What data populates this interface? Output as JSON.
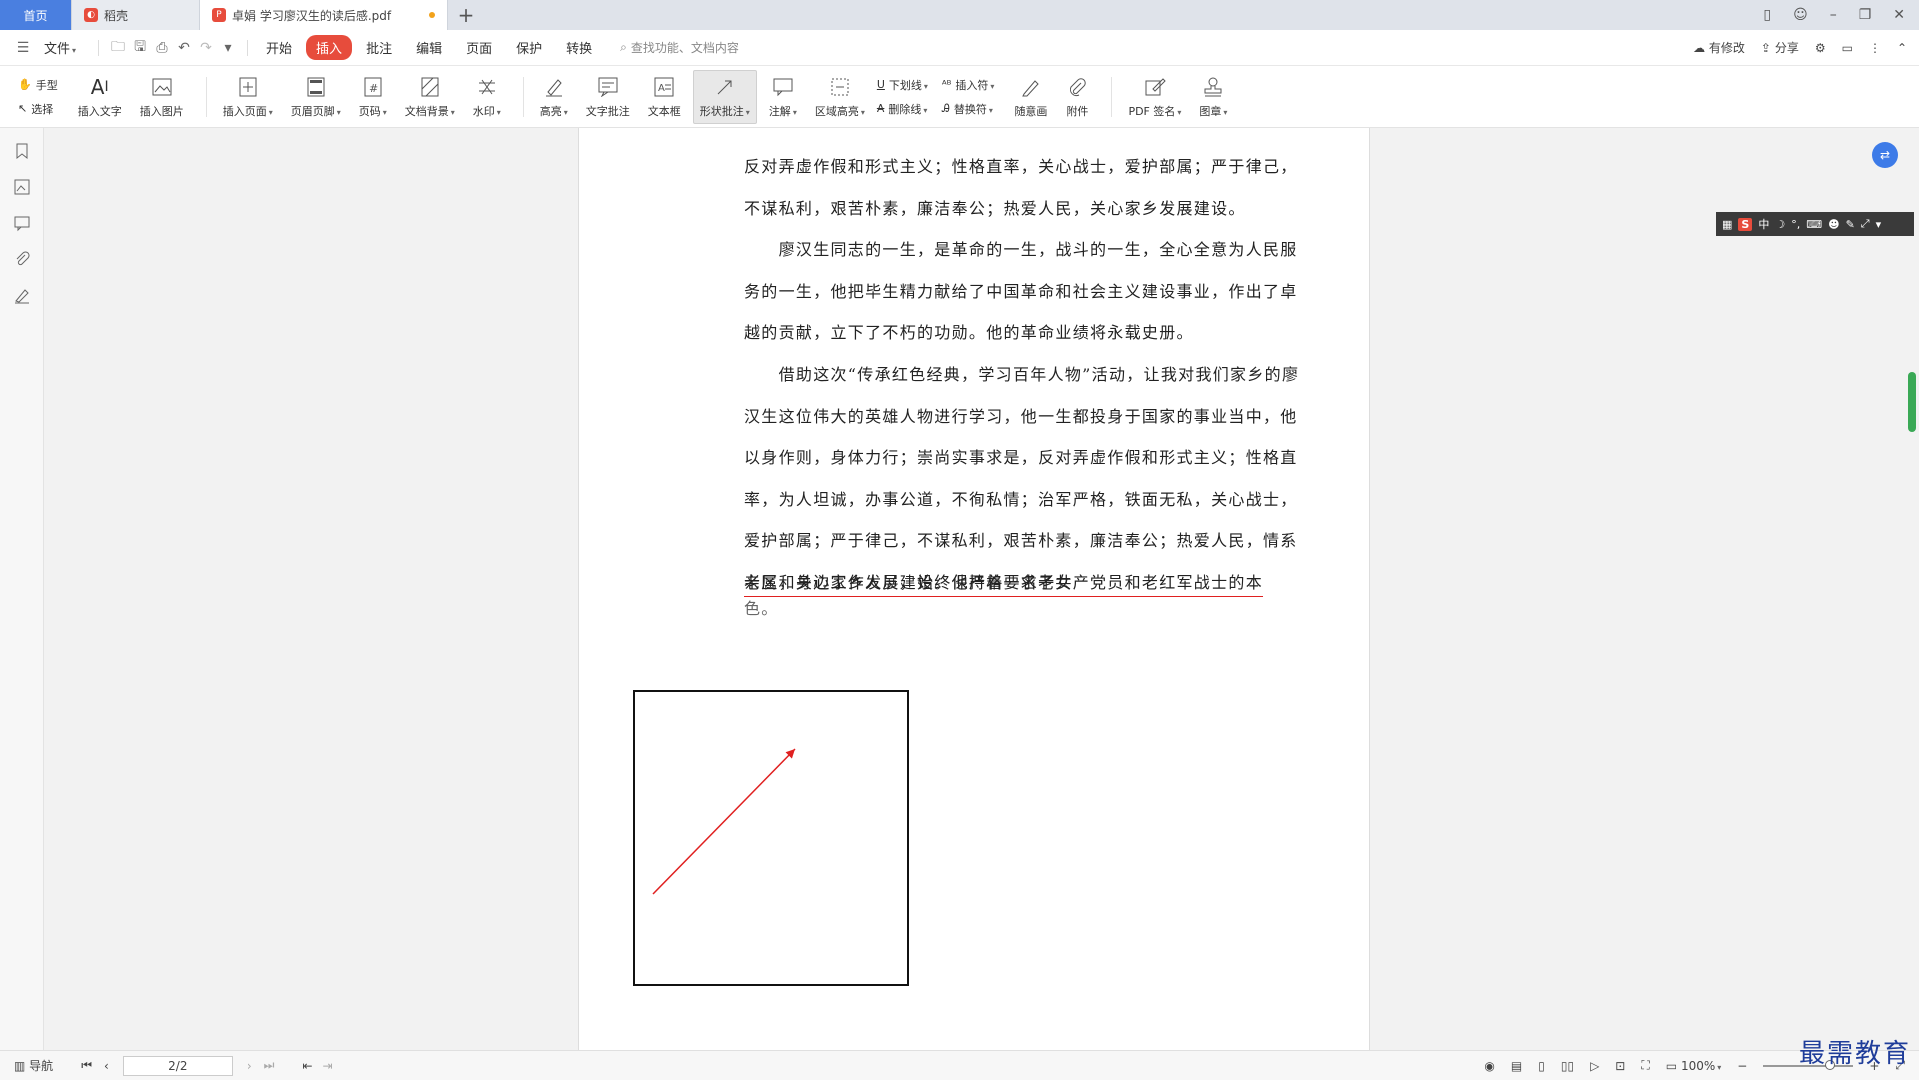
{
  "tabs": {
    "home": "首页",
    "wps": "稻壳",
    "doc": "卓娟 学习廖汉生的读后感.pdf"
  },
  "menu": {
    "file": "文件",
    "items": [
      "开始",
      "插入",
      "批注",
      "编辑",
      "页面",
      "保护",
      "转换"
    ],
    "search_placeholder": "查找功能、文档内容",
    "has_changes": "有修改",
    "share": "分享"
  },
  "ribbon": {
    "hand": "手型",
    "select": "选择",
    "insert_text": "插入文字",
    "insert_image": "插入图片",
    "insert_page": "插入页面",
    "header_footer": "页眉页脚",
    "page_num": "页码",
    "doc_bg": "文档背景",
    "watermark": "水印",
    "highlight": "高亮",
    "text_note": "文字批注",
    "text_box": "文本框",
    "shape_note": "形状批注",
    "annotation": "注解",
    "area_highlight": "区域高亮",
    "underline": "下划线",
    "strikethrough": "删除线",
    "insert_symbol": "插入符",
    "replace_symbol": "替换符",
    "freehand": "随意画",
    "attachment": "附件",
    "pdf_sign": "PDF 签名",
    "stamp": "图章"
  },
  "document": {
    "paragraphs": [
      "反对弄虚作假和形式主义；性格直率，关心战士，爱护部属；严于律己，不谋私利，艰苦朴素，廉洁奉公；热爱人民，关心家乡发展建设。",
      "　　廖汉生同志的一生，是革命的一生，战斗的一生，全心全意为人民服务的一生，他把毕生精力献给了中国革命和社会主义建设事业，作出了卓越的贡献，立下了不朽的功勋。他的革命业绩将永载史册。",
      "　　借助这次“传承红色经典，学习百年人物”活动，让我对我们家乡的廖汉生这位伟大的英雄人物进行学习，他一生都投身于国家的事业当中，他以身作则，身体力行；崇尚实事求是，反对弄虚作假和形式主义；性格直率，为人坦诚，办事公道，不徇私情；治军严格，铁面无私，关心战士，爱护部属；严于律己，不谋私利，艰苦朴素，廉洁奉公；热爱人民，情系老区，关心家乡发展建设。他严格要求子女"
    ],
    "underlined_line": "亲属和身边工作人员，始终保持着一名老共产党员和老红军战士的本",
    "last_line": "色。"
  },
  "ime": {
    "logo": "S",
    "lang": "中"
  },
  "statusbar": {
    "nav": "导航",
    "page": "2/2",
    "zoom": "100%"
  },
  "watermark": "最需教育",
  "colors": {
    "accent": "#e74c3c",
    "blue": "#4a7fe0",
    "arrow": "#e02020"
  }
}
